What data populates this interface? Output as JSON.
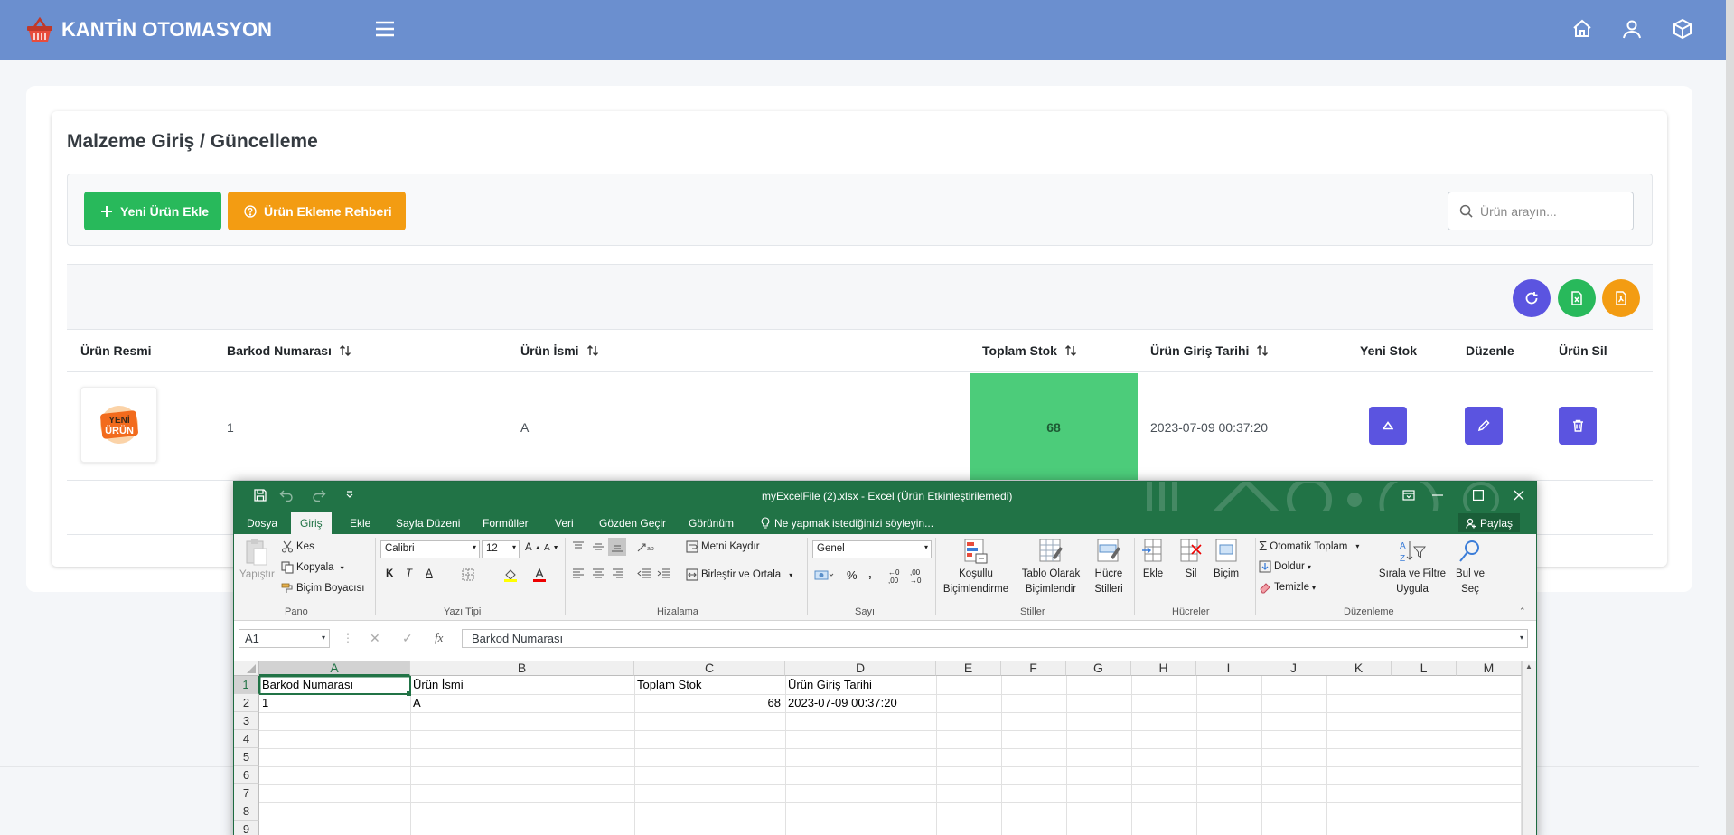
{
  "app": {
    "brand": "KANTİN OTOMASYON"
  },
  "page": {
    "title": "Malzeme Giriş / Güncelleme"
  },
  "toolbar": {
    "new_product": "Yeni Ürün Ekle",
    "guide": "Ürün Ekleme Rehberi",
    "search_placeholder": "Ürün arayın..."
  },
  "table": {
    "columns": [
      "Ürün Resmi",
      "Barkod Numarası",
      "Ürün İsmi",
      "Toplam Stok",
      "Ürün Giriş Tarihi",
      "Yeni Stok",
      "Düzenle",
      "Ürün Sil"
    ],
    "row": {
      "image_label_top": "YENİ",
      "image_label_bottom": "ÜRÜN",
      "barcode": "1",
      "name": "A",
      "stock": "68",
      "date": "2023-07-09 00:37:20"
    }
  },
  "excel": {
    "title": "myExcelFile (2).xlsx  -  Excel (Ürün Etkinleştirilemedi)",
    "tabs": [
      "Dosya",
      "Giriş",
      "Ekle",
      "Sayfa Düzeni",
      "Formüller",
      "Veri",
      "Gözden Geçir",
      "Görünüm"
    ],
    "tell_me": "Ne yapmak istediğinizi söyleyin...",
    "share": "Paylaş",
    "ribbon": {
      "paste": "Yapıştır",
      "cut": "Kes",
      "copy": "Kopyala",
      "format_painter": "Biçim Boyacısı",
      "group_clipboard": "Pano",
      "font": "Calibri",
      "size": "12",
      "bold": "K",
      "italic": "T",
      "underline": "A",
      "group_font": "Yazı Tipi",
      "wrap": "Metni Kaydır",
      "merge": "Birleştir ve Ortala",
      "group_align": "Hizalama",
      "number_format": "Genel",
      "group_number": "Sayı",
      "cond_1": "Koşullu",
      "cond_2": "Biçimlendirme",
      "table_1": "Tablo Olarak",
      "table_2": "Biçimlendir",
      "styles_1": "Hücre",
      "styles_2": "Stilleri",
      "group_styles": "Stiller",
      "insert": "Ekle",
      "delete": "Sil",
      "format": "Biçim",
      "group_cells": "Hücreler",
      "autosum": "Otomatik Toplam",
      "fill": "Doldur",
      "clear": "Temizle",
      "sort_1": "Sırala ve Filtre",
      "sort_2": "Uygula",
      "find_1": "Bul ve",
      "find_2": "Seç",
      "group_edit": "Düzenleme"
    },
    "namebox": "A1",
    "formula": "Barkod Numarası",
    "columns": [
      "A",
      "B",
      "C",
      "D",
      "E",
      "F",
      "G",
      "H",
      "I",
      "J",
      "K",
      "L",
      "M"
    ],
    "rows": [
      "1",
      "2",
      "3",
      "4",
      "5",
      "6",
      "7",
      "8",
      "9"
    ],
    "cells": {
      "a1": "Barkod Numarası",
      "b1": "Ürün İsmi",
      "c1": "Toplam Stok",
      "d1": "Ürün Giriş Tarihi",
      "a2": "1",
      "b2": "A",
      "c2": "68",
      "d2": "2023-07-09 00:37:20"
    }
  }
}
